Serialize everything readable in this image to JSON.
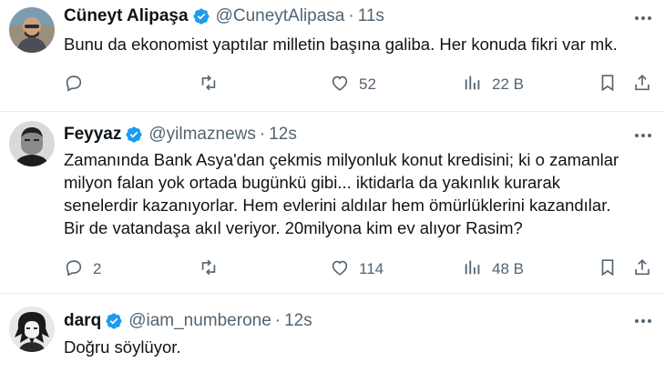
{
  "tweets": [
    {
      "name": "Cüneyt Alipaşa",
      "handle": "@CuneytAlipasa",
      "dot": "·",
      "time": "11s",
      "text": "Bunu da ekonomist yaptılar milletin başına galiba. Her konuda fikri var mk.",
      "replies": "",
      "retweets": "",
      "likes": "52",
      "views": "22 B"
    },
    {
      "name": "Feyyaz",
      "handle": "@yilmaznews",
      "dot": "·",
      "time": "12s",
      "text": "Zamanında Bank Asya'dan çekmis milyonluk konut kredisini; ki o zamanlar\nmilyon falan yok ortada bugünkü gibi... iktidarla da yakınlık kurarak\nsenelerdir kazanıyorlar. Hem evlerini aldılar hem ömürlüklerini kazandılar.\nBir de vatandaşa akıl veriyor. 20milyona kim ev alıyor Rasim?",
      "replies": "2",
      "retweets": "",
      "likes": "114",
      "views": "48 B"
    },
    {
      "name": "darq",
      "handle": "@iam_numberone",
      "dot": "·",
      "time": "12s",
      "text": "Doğru söylüyor."
    }
  ],
  "colors": {
    "text": "#0f1419",
    "secondary": "#536471",
    "verified": "#1d9bf0",
    "divider": "#e6ecf0"
  },
  "icons": [
    "verified-badge-icon",
    "more-icon",
    "reply-icon",
    "retweet-icon",
    "like-icon",
    "views-icon",
    "bookmark-icon",
    "share-icon"
  ]
}
